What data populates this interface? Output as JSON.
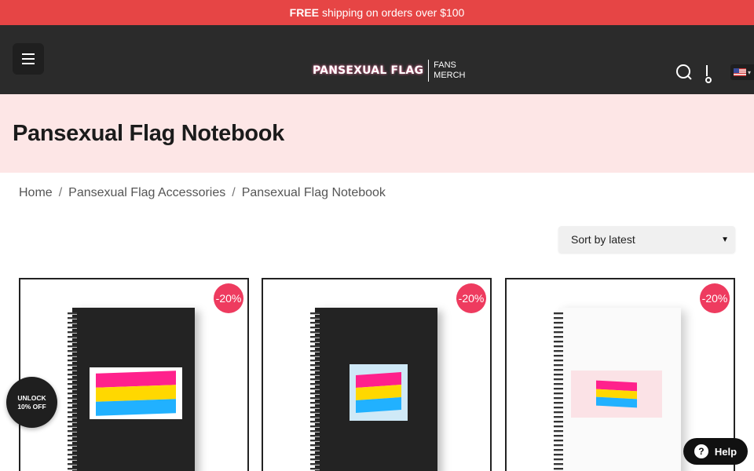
{
  "topbar": {
    "free": "FREE",
    "message": "shipping on orders over $100"
  },
  "header": {
    "logo_main": "PANSEXUAL FLAG",
    "logo_sub_1": "FANS",
    "logo_sub_2": "MERCH",
    "icons": [
      "menu-icon",
      "search-icon",
      "cart-icon",
      "us-flag-icon"
    ]
  },
  "page": {
    "title": "Pansexual Flag Notebook"
  },
  "breadcrumb": {
    "home": "Home",
    "sep": "/",
    "category": "Pansexual Flag Accessories",
    "current": "Pansexual Flag Notebook"
  },
  "sort": {
    "selected": "Sort by latest"
  },
  "products": [
    {
      "badge": "-20%"
    },
    {
      "badge": "-20%"
    },
    {
      "badge": "-20%"
    }
  ],
  "popup": {
    "line1": "UNLOCK",
    "line2": "10% OFF"
  },
  "help": {
    "icon": "?",
    "label": "Help"
  },
  "colors": {
    "topbar": "#e64545",
    "header": "#2b2b2b",
    "title_band": "#fde6e6",
    "badge": "#ee3b5f",
    "pan_pink": "#ff218c",
    "pan_yellow": "#ffd800",
    "pan_blue": "#21b1ff"
  }
}
